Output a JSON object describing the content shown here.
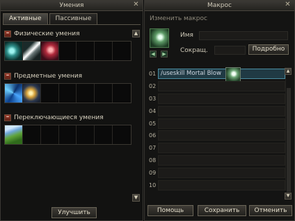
{
  "skills_window": {
    "title": "Умения",
    "tabs": [
      {
        "label": "Активные",
        "active": true
      },
      {
        "label": "Пассивные",
        "active": false
      }
    ],
    "sections": [
      {
        "title": "Физические умения",
        "icons": [
          "claw-skill-icon",
          "blade-skill-icon",
          "strike-skill-icon"
        ]
      },
      {
        "title": "Предметные умения",
        "icons": [
          "swirl-skill-icon",
          "gold-skill-icon"
        ]
      },
      {
        "title": "Переключающиеся умения",
        "icons": [
          "nature-skill-icon"
        ]
      }
    ],
    "improve_button": "Улучшить"
  },
  "macro_window": {
    "title": "Макрос",
    "subtitle": "Изменить макрос",
    "name_label": "Имя",
    "short_label": "Сокращ.",
    "details_button": "Подробно",
    "rows": [
      {
        "num": "01",
        "text": "/useskill Mortal Blow"
      },
      {
        "num": "02",
        "text": ""
      },
      {
        "num": "03",
        "text": ""
      },
      {
        "num": "04",
        "text": ""
      },
      {
        "num": "05",
        "text": ""
      },
      {
        "num": "06",
        "text": ""
      },
      {
        "num": "07",
        "text": ""
      },
      {
        "num": "08",
        "text": ""
      },
      {
        "num": "09",
        "text": ""
      },
      {
        "num": "10",
        "text": ""
      }
    ],
    "buttons": {
      "help": "Помощь",
      "save": "Сохранить",
      "cancel": "Отменить"
    }
  }
}
